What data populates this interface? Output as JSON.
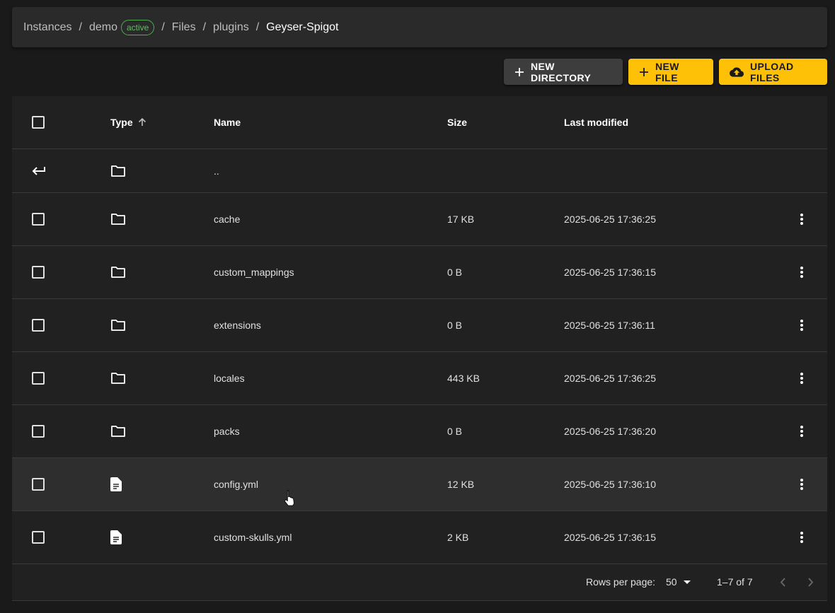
{
  "breadcrumb": {
    "items": [
      "Instances",
      "demo",
      "Files",
      "plugins",
      "Geyser-Spigot"
    ],
    "separator": "/",
    "status_badge": "active"
  },
  "toolbar": {
    "new_directory_label": "New Directory",
    "new_file_label": "New File",
    "upload_files_label": "Upload Files"
  },
  "table": {
    "headers": {
      "type": "Type",
      "name": "Name",
      "size": "Size",
      "modified": "Last modified"
    },
    "parent_row": {
      "name": ".."
    },
    "rows": [
      {
        "type": "folder",
        "name": "cache",
        "size": "17 KB",
        "modified": "2025-06-25 17:36:25"
      },
      {
        "type": "folder",
        "name": "custom_mappings",
        "size": "0 B",
        "modified": "2025-06-25 17:36:15"
      },
      {
        "type": "folder",
        "name": "extensions",
        "size": "0 B",
        "modified": "2025-06-25 17:36:11"
      },
      {
        "type": "folder",
        "name": "locales",
        "size": "443 KB",
        "modified": "2025-06-25 17:36:25"
      },
      {
        "type": "folder",
        "name": "packs",
        "size": "0 B",
        "modified": "2025-06-25 17:36:20"
      },
      {
        "type": "file",
        "name": "config.yml",
        "size": "12 KB",
        "modified": "2025-06-25 17:36:10"
      },
      {
        "type": "file",
        "name": "custom-skulls.yml",
        "size": "2 KB",
        "modified": "2025-06-25 17:36:15"
      }
    ]
  },
  "pagination": {
    "rows_per_page_label": "Rows per page:",
    "rows_per_page_value": "50",
    "range": "1–7 of 7"
  },
  "colors": {
    "accent": "#ffc107",
    "badge": "#66bb6a",
    "background": "#1a1a1a",
    "surface": "#212121"
  }
}
